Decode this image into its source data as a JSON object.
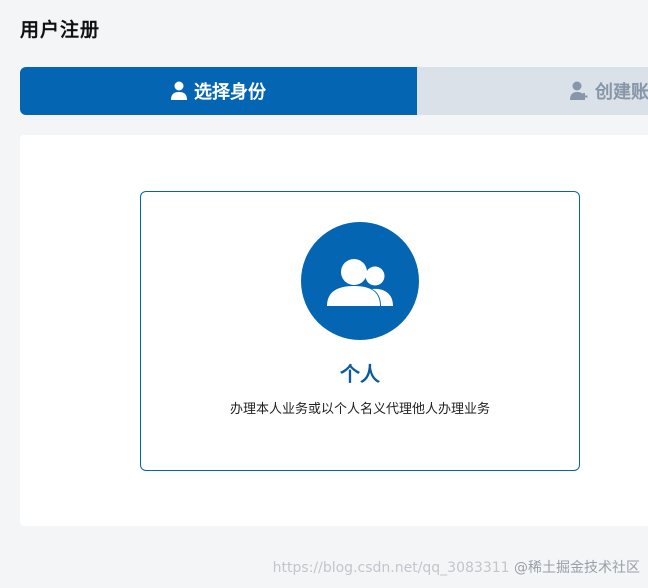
{
  "page": {
    "title": "用户注册"
  },
  "steps": [
    {
      "label": "选择身份",
      "icon": "user-icon",
      "state": "active"
    },
    {
      "label": "创建账",
      "icon": "add-user-icon",
      "state": "inactive"
    }
  ],
  "identity_card": {
    "icon": "group-users-icon",
    "title": "个人",
    "description": "办理本人业务或以个人名义代理他人办理业务"
  },
  "watermark": {
    "prefix": "https://blog.csdn.net/qq_3083311",
    "brand": "@稀土掘金技术社区"
  },
  "colors": {
    "accent": "#0466b3",
    "inactive_step_bg": "#dbe1e8",
    "inactive_step_text": "#8796a8",
    "page_bg": "#f3f5f7"
  }
}
